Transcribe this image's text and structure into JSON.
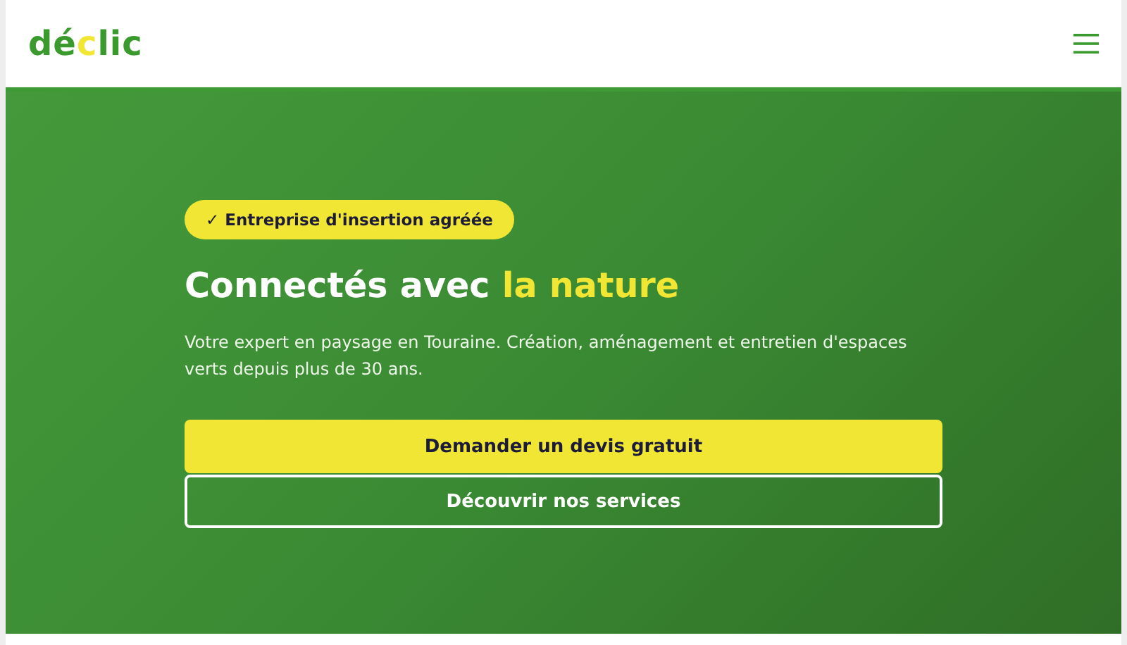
{
  "header": {
    "logo": [
      {
        "text": "dé",
        "highlight": false
      },
      {
        "text": "c",
        "highlight": true
      },
      {
        "text": "lic",
        "highlight": false
      }
    ]
  },
  "hero": {
    "badge": "✓ Entreprise d'insertion agréée",
    "title": [
      {
        "text": "Connectés avec ",
        "highlight": false
      },
      {
        "text": "la nature",
        "highlight": true
      }
    ],
    "description": "Votre expert en paysage en Touraine. Création, aménagement et entretien d'espaces verts depuis plus de 30 ans.",
    "buttons": [
      {
        "label": "Demander un devis gratuit",
        "kind": "primary"
      },
      {
        "label": "Découvrir nos services",
        "kind": "outline"
      }
    ]
  }
}
